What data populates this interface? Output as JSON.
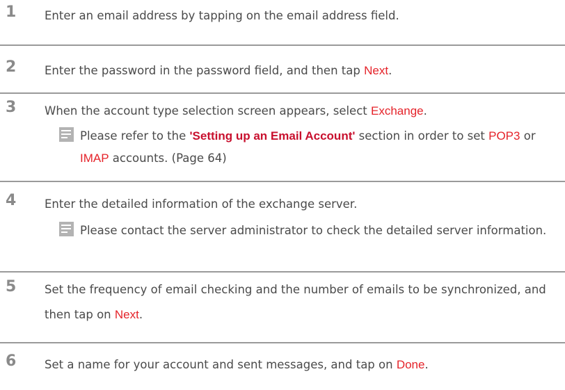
{
  "steps": [
    {
      "number": "1",
      "parts": [
        {
          "t": "Enter an email address by tapping on the email address field.",
          "s": "plain"
        }
      ]
    },
    {
      "number": "2",
      "parts": [
        {
          "t": "Enter the password in the password field, and then tap ",
          "s": "plain"
        },
        {
          "t": "Next",
          "s": "hl"
        },
        {
          "t": ".",
          "s": "plain"
        }
      ]
    },
    {
      "number": "3",
      "parts": [
        {
          "t": "When the account type selection screen appears, select ",
          "s": "plain"
        },
        {
          "t": "Exchange",
          "s": "hl"
        },
        {
          "t": ".",
          "s": "plain"
        }
      ],
      "note": [
        {
          "t": "Please refer to the ",
          "s": "plain"
        },
        {
          "t": "'Setting up an Email Account'",
          "s": "bold"
        },
        {
          "t": " section in order to set ",
          "s": "plain"
        },
        {
          "t": "POP3",
          "s": "hl"
        },
        {
          "t": " or ",
          "s": "plain"
        },
        {
          "t": "IMAP",
          "s": "hl"
        },
        {
          "t": " accounts. (Page 64)",
          "s": "plain"
        }
      ]
    },
    {
      "number": "4",
      "parts": [
        {
          "t": "Enter the detailed information of the exchange server.",
          "s": "plain"
        }
      ],
      "note": [
        {
          "t": "Please contact the server administrator to check the detailed server information.",
          "s": "plain"
        }
      ]
    },
    {
      "number": "5",
      "parts": [
        {
          "t": "Set the frequency of email checking and the number of emails to be synchronized, and then tap on ",
          "s": "plain"
        },
        {
          "t": "Next",
          "s": "hl"
        },
        {
          "t": ".",
          "s": "plain"
        }
      ]
    },
    {
      "number": "6",
      "parts": [
        {
          "t": "Set a name for your account and sent messages, and tap on ",
          "s": "plain"
        },
        {
          "t": "Done",
          "s": "hl"
        },
        {
          "t": ".",
          "s": "plain"
        }
      ]
    }
  ],
  "colors": {
    "highlight": "#e5232a",
    "bold_quote": "#c8102e",
    "text": "#4a4a4a",
    "step_number": "#8a8a8a",
    "divider": "#9a9a9a",
    "note_icon": "#b3b3b3"
  },
  "icons": {
    "note": "note-icon"
  }
}
